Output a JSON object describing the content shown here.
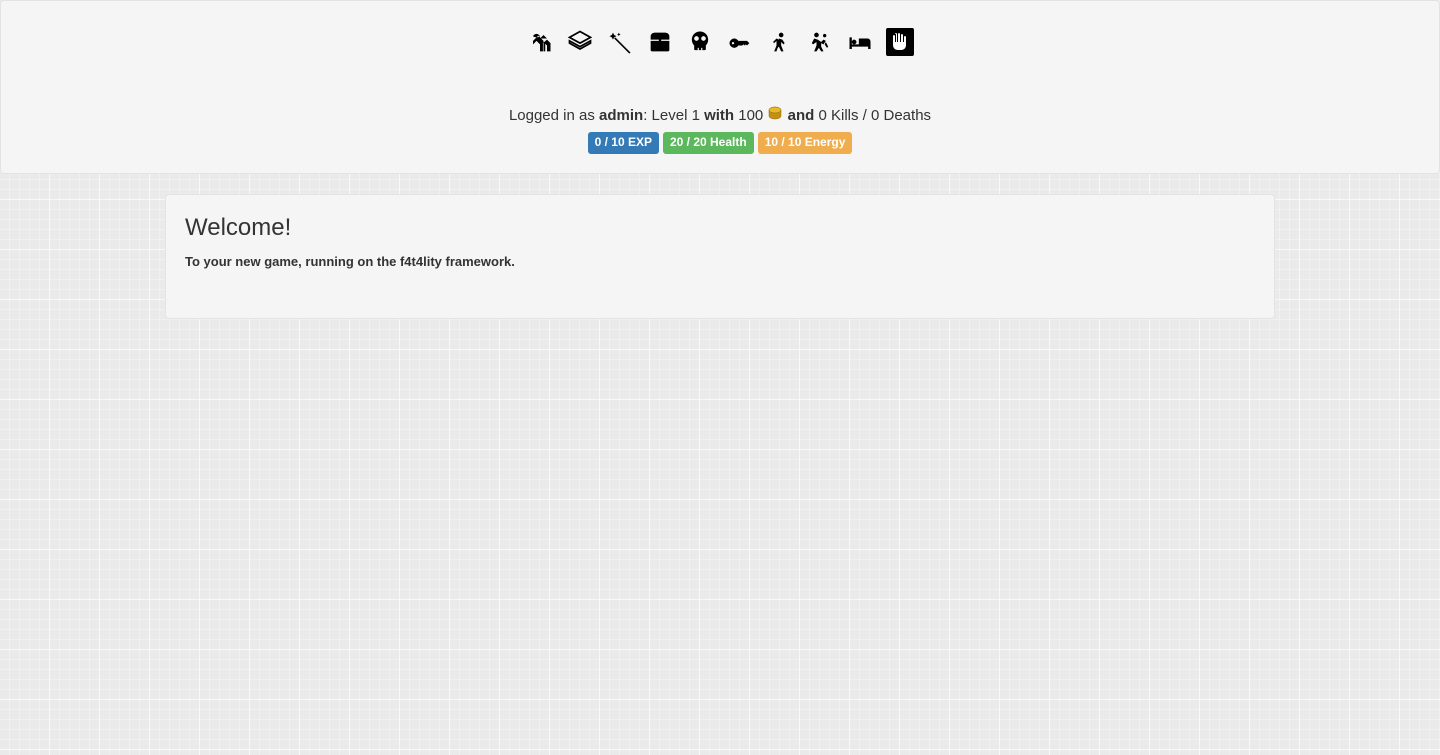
{
  "nav": {
    "items": [
      {
        "name": "village-icon"
      },
      {
        "name": "book-icon"
      },
      {
        "name": "wand-icon"
      },
      {
        "name": "chest-icon"
      },
      {
        "name": "skull-icon"
      },
      {
        "name": "key-icon"
      },
      {
        "name": "walker-icon"
      },
      {
        "name": "fight-icon"
      },
      {
        "name": "bed-icon"
      },
      {
        "name": "hand-stop-icon"
      }
    ]
  },
  "status": {
    "logged_in_as": "Logged in as ",
    "username": "admin",
    "level_prefix": ": Level ",
    "level": "1",
    "with_word": " with ",
    "gold": "100",
    "and_word": " and ",
    "kills": "0",
    "kills_word": " Kills / ",
    "deaths": "0",
    "deaths_word": " Deaths"
  },
  "badges": {
    "exp": "0 / 10 EXP",
    "health": "20 / 20 Health",
    "energy": "10 / 10 Energy"
  },
  "main": {
    "title": "Welcome!",
    "subtitle": "To your new game, running on the f4t4lity framework."
  }
}
